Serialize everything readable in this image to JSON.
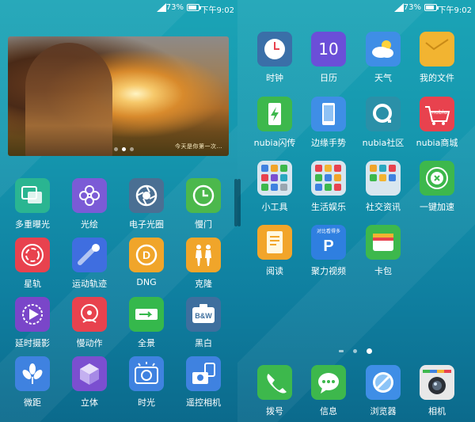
{
  "status_bar": {
    "battery": "73%",
    "time": "下午9:02"
  },
  "left_screen": {
    "photo_widget": {
      "caption": "今天是你第一次…",
      "page_count": 3,
      "active_page": 2
    },
    "apps": [
      {
        "label": "多重曝光",
        "icon": "multi-exposure-icon",
        "color": "#2ab591"
      },
      {
        "label": "光绘",
        "icon": "light-painting-icon",
        "color": "#7b5bd6"
      },
      {
        "label": "电子光圈",
        "icon": "aperture-icon",
        "color": "#4a6f93"
      },
      {
        "label": "慢门",
        "icon": "slow-shutter-icon",
        "color": "#4cb84c"
      },
      {
        "label": "星轨",
        "icon": "star-trail-icon",
        "color": "#e8424e"
      },
      {
        "label": "运动轨迹",
        "icon": "motion-trail-icon",
        "color": "#3f6ee0"
      },
      {
        "label": "DNG",
        "icon": "dng-icon",
        "color": "#f0a52a"
      },
      {
        "label": "克隆",
        "icon": "clone-icon",
        "color": "#f0a52a"
      },
      {
        "label": "延时摄影",
        "icon": "time-lapse-icon",
        "color": "#7a46c9"
      },
      {
        "label": "慢动作",
        "icon": "slow-motion-icon",
        "color": "#e8424e"
      },
      {
        "label": "全景",
        "icon": "panorama-icon",
        "color": "#35b84c"
      },
      {
        "label": "黑白",
        "icon": "black-white-icon",
        "color": "#3e6f9e"
      },
      {
        "label": "微距",
        "icon": "macro-icon",
        "color": "#3f82e0"
      },
      {
        "label": "立体",
        "icon": "3d-icon",
        "color": "#7b4fd0"
      },
      {
        "label": "时光",
        "icon": "time-icon",
        "color": "#3f82e0"
      },
      {
        "label": "遥控相机",
        "icon": "remote-camera-icon",
        "color": "#3f82e0"
      }
    ]
  },
  "right_screen": {
    "apps": [
      {
        "label": "时钟",
        "icon": "clock-icon",
        "color": "#3a6fa8"
      },
      {
        "label": "日历",
        "icon": "calendar-icon",
        "color": "#6b4fd8",
        "value": "10"
      },
      {
        "label": "天气",
        "icon": "weather-icon",
        "color": "#3f8ee6"
      },
      {
        "label": "我的文件",
        "icon": "folder-icon",
        "color": "#f2b431"
      },
      {
        "label": "nubia闪传",
        "icon": "flash-transfer-icon",
        "color": "#3db84c"
      },
      {
        "label": "边缘手势",
        "icon": "edge-gesture-icon",
        "color": "#3f8ee6"
      },
      {
        "label": "nubia社区",
        "icon": "community-icon",
        "color": "#2a90a8"
      },
      {
        "label": "nubia商城",
        "icon": "shop-icon",
        "color": "#e8424e",
        "value": "nubia"
      },
      {
        "label": "小工具",
        "icon": "tools-folder-icon",
        "color": "#d8e6ef"
      },
      {
        "label": "生活娱乐",
        "icon": "life-folder-icon",
        "color": "#d8e6ef"
      },
      {
        "label": "社交资讯",
        "icon": "social-folder-icon",
        "color": "#d8e6ef"
      },
      {
        "label": "一键加速",
        "icon": "boost-icon",
        "color": "#3db84c"
      },
      {
        "label": "阅读",
        "icon": "reading-icon",
        "color": "#f2a52a"
      },
      {
        "label": "聚力视频",
        "icon": "pptv-icon",
        "color": "#2f7fe0",
        "value": "对比看得多"
      },
      {
        "label": "卡包",
        "icon": "wallet-icon",
        "color": "#3db84c"
      }
    ],
    "page_indicator": {
      "count": 3,
      "active": 2
    },
    "dock": [
      {
        "label": "拨号",
        "icon": "phone-icon",
        "color": "#3db84c"
      },
      {
        "label": "信息",
        "icon": "message-icon",
        "color": "#3db84c"
      },
      {
        "label": "浏览器",
        "icon": "browser-icon",
        "color": "#3f8ee6"
      },
      {
        "label": "相机",
        "icon": "camera-icon",
        "color": "#e8e8e8"
      }
    ]
  }
}
